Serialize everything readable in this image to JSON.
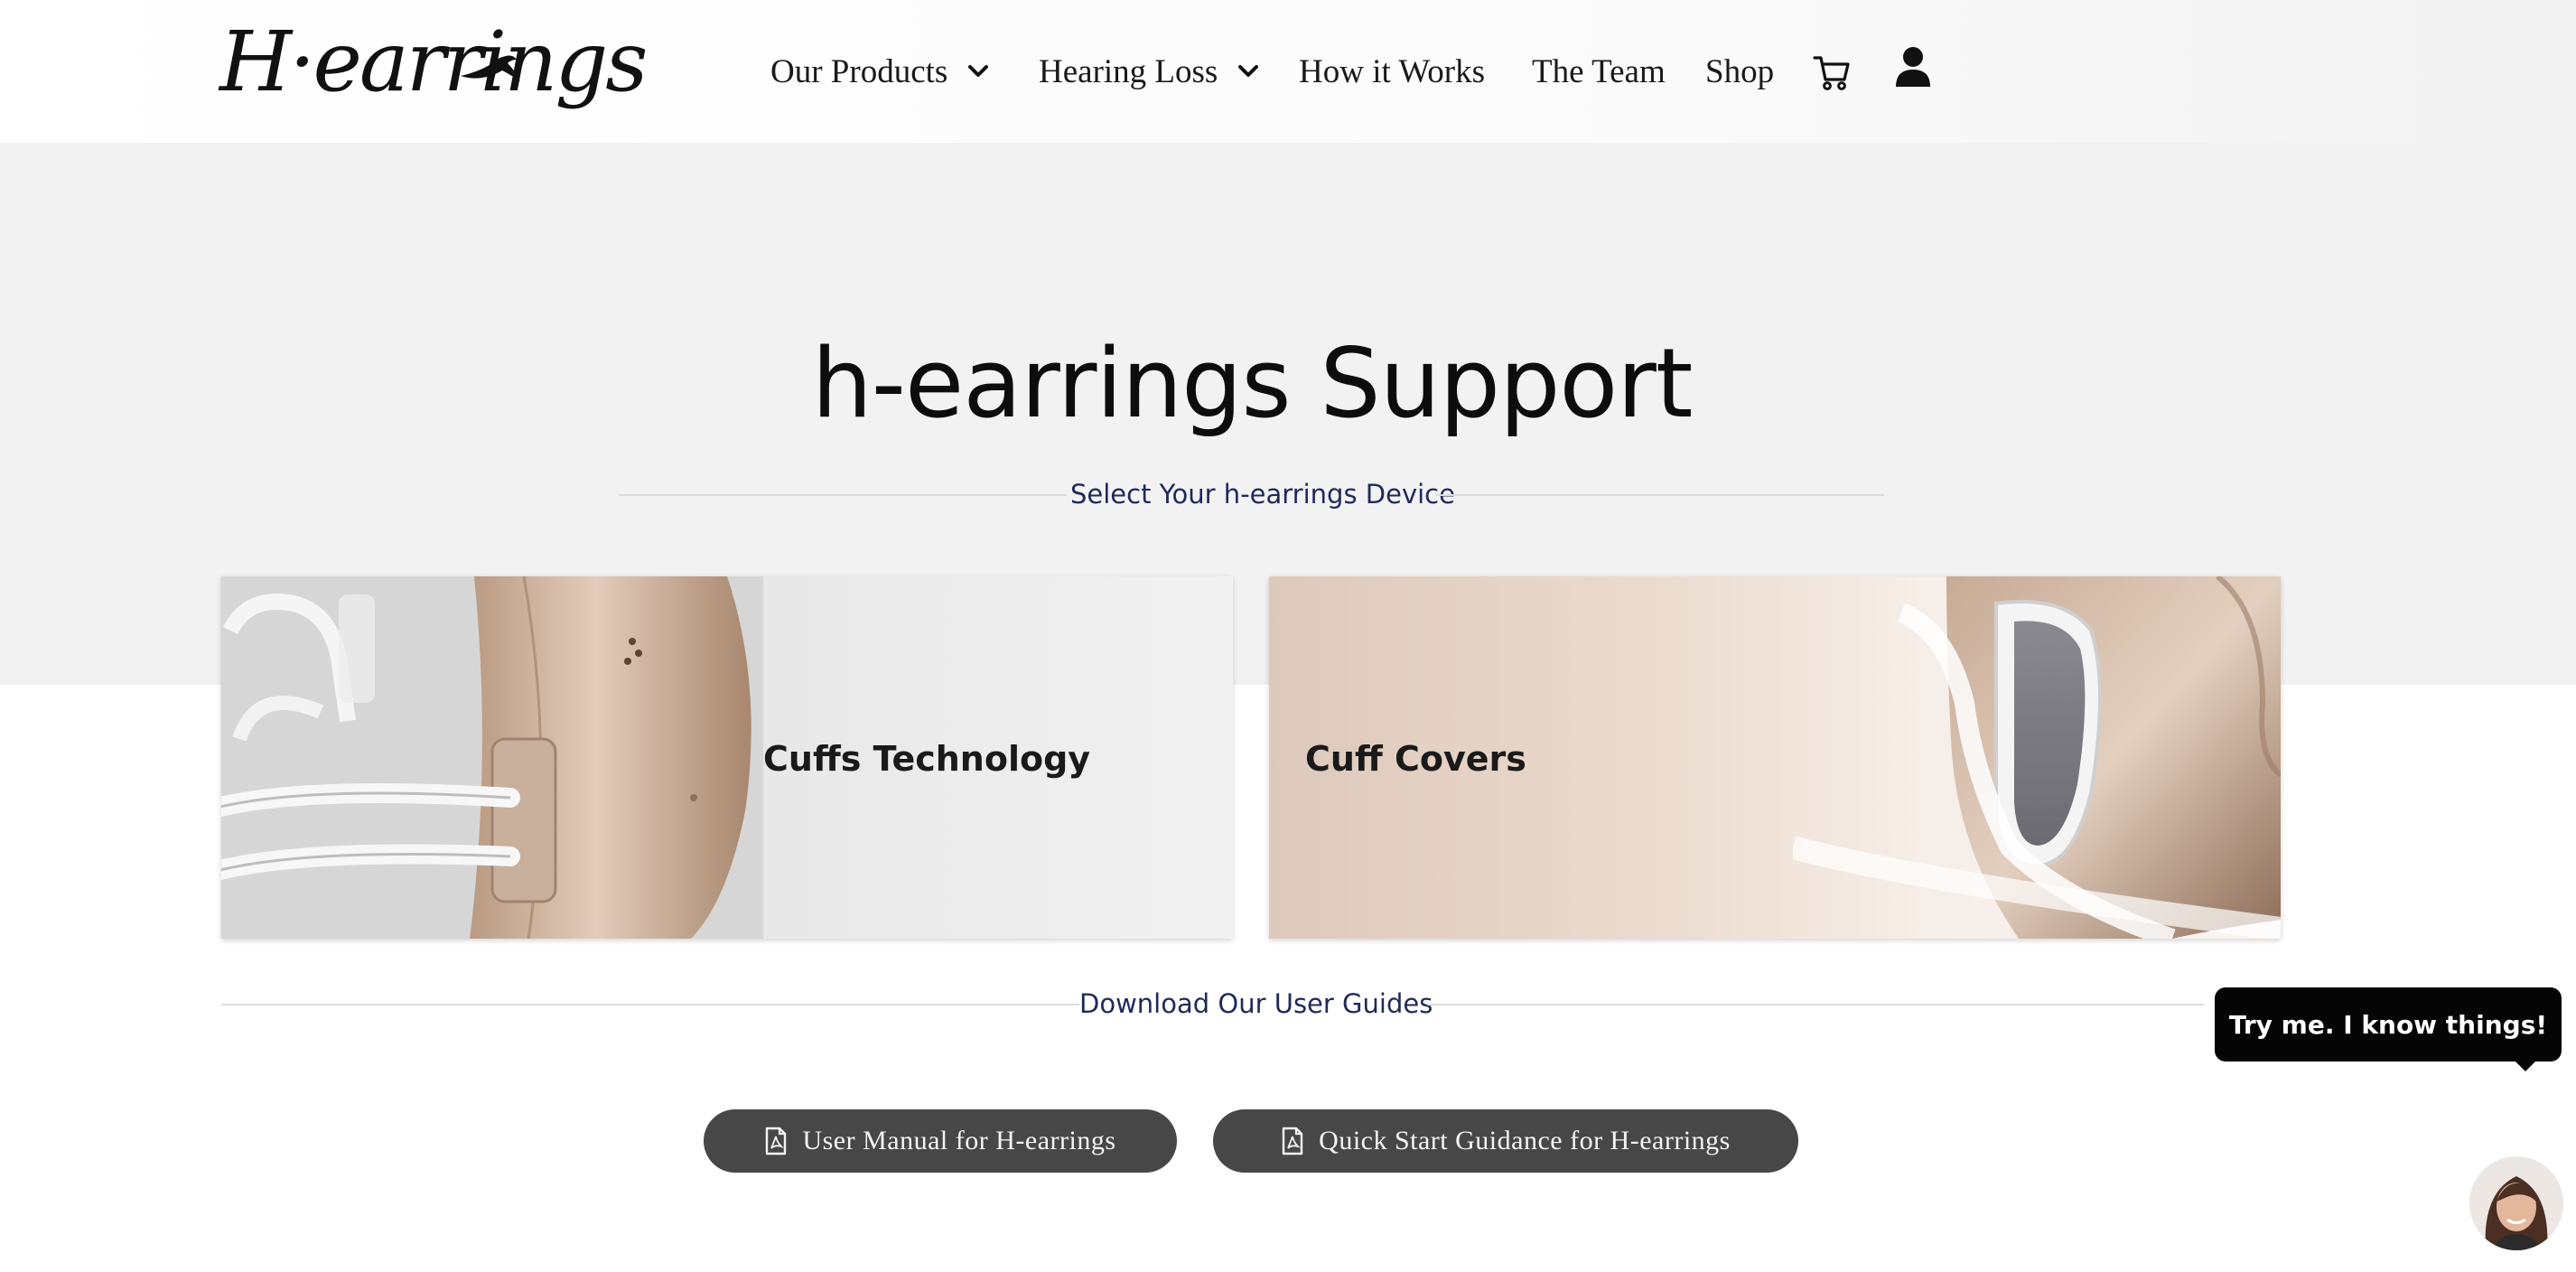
{
  "header": {
    "logo_text": "H·earrings",
    "nav": [
      {
        "label": "Our Products",
        "dropdown": true
      },
      {
        "label": "Hearing Loss",
        "dropdown": true
      },
      {
        "label": "How it Works",
        "dropdown": false
      },
      {
        "label": "The Team",
        "dropdown": false
      },
      {
        "label": "Shop",
        "dropdown": false
      }
    ],
    "icons": [
      "cart-icon",
      "user-icon"
    ]
  },
  "main": {
    "title": "h-earrings Support",
    "device_section_label": "Select Your h-earrings Device",
    "devices": [
      {
        "label": "Cuffs Technology"
      },
      {
        "label": "Cuff Covers"
      }
    ],
    "guides_section_label": "Download Our User Guides",
    "guides": [
      {
        "label": "User Manual for H-earrings",
        "icon": "pdf-file-icon"
      },
      {
        "label": "Quick Start Guidance for H-earrings",
        "icon": "pdf-file-icon"
      }
    ]
  },
  "chat": {
    "prompt": "Try me. I know things!"
  },
  "colors": {
    "hero_bg": "#f2f2f2",
    "section_label": "#1f2a5a",
    "button_bg": "#474747",
    "chat_bg": "#050505"
  }
}
